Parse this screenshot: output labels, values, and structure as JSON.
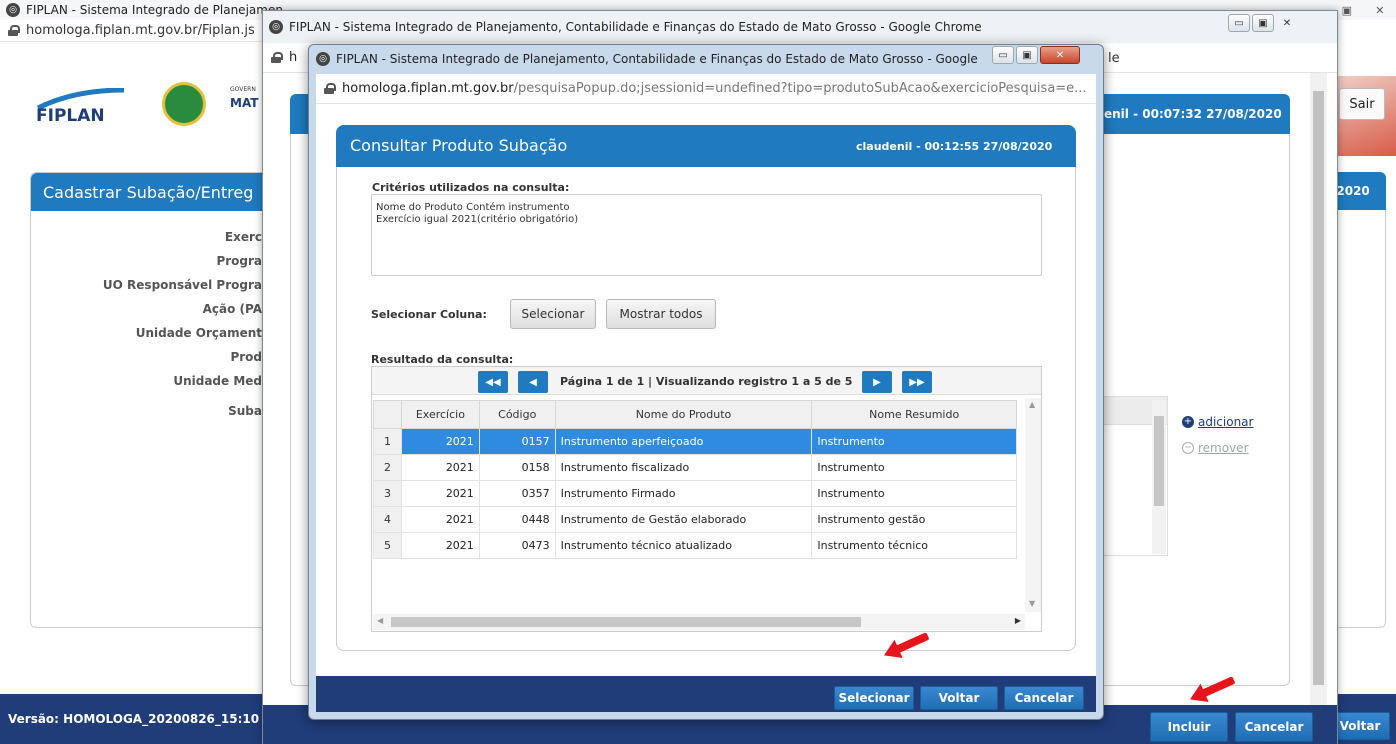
{
  "back": {
    "title": "FIPLAN - Sistema Integrado de Planejamen",
    "url": "homologa.fiplan.mt.gov.br/Fiplan.js",
    "logo": "FIPLAN",
    "gov": "GOVERN",
    "gov2": "MAT",
    "sair": "Sair",
    "form_title": "Cadastrar Subação/Entreg",
    "fields": [
      "Exerc",
      "Progra",
      "UO Responsável Progra",
      "Ação (PA",
      "Unidade Orçament",
      "Prod",
      "Unidade Med",
      "Suba"
    ],
    "version": "Versão: HOMOLOGA_20200826_15:10",
    "voltar": "Voltar",
    "date_right": "/2020"
  },
  "mid": {
    "title": "FIPLAN - Sistema Integrado de Planejamento, Contabilidade e Finanças do Estado de Mato Grosso - Google Chrome",
    "url_frag": "h",
    "url_frag_right": "le",
    "session": "enil - 00:07:32 27/08/2020",
    "adicionar": "adicionar",
    "remover": "remover",
    "incluir": "Incluir",
    "cancelar": "Cancelar"
  },
  "popup": {
    "title": "FIPLAN - Sistema Integrado de Planejamento, Contabilidade e Finanças do Estado de Mato Grosso - Google Chrome",
    "url_host": "homologa.fiplan.mt.gov.br",
    "url_path": "/pesquisaPopup.do;jsessionid=undefined?tipo=produtoSubAcao&exercicioPesquisa=e...",
    "panel_title": "Consultar Produto Subação",
    "session": "claudenil - 00:12:55 27/08/2020",
    "criteria_label": "Critérios utilizados na consulta:",
    "criteria_line1": "Nome do Produto Contém instrumento",
    "criteria_line2": "Exercício igual 2021(critério obrigatório)",
    "select_col_label": "Selecionar Coluna:",
    "btn_selecionar": "Selecionar",
    "btn_mostrar": "Mostrar todos",
    "result_label": "Resultado da consulta:",
    "pager": "Página 1 de 1 | Visualizando registro 1 a 5 de 5",
    "columns": [
      "Exercício",
      "Código",
      "Nome do Produto",
      "Nome Resumido"
    ],
    "rows": [
      [
        "1",
        "2021",
        "0157",
        "Instrumento aperfeiçoado",
        "Instrumento"
      ],
      [
        "2",
        "2021",
        "0158",
        "Instrumento fiscalizado",
        "Instrumento"
      ],
      [
        "3",
        "2021",
        "0357",
        "Instrumento Firmado",
        "Instrumento"
      ],
      [
        "4",
        "2021",
        "0448",
        "Instrumento de Gestão elaborado",
        "Instrumento gestão"
      ],
      [
        "5",
        "2021",
        "0473",
        "Instrumento técnico atualizado",
        "Instrumento técnico"
      ]
    ],
    "footer_selecionar": "Selecionar",
    "footer_voltar": "Voltar",
    "footer_cancelar": "Cancelar"
  },
  "colors": {
    "header_blue": "#1f7abf",
    "nav_blue": "#203d7a",
    "selected_row": "#2f8be0",
    "arrow_red": "#e8141c"
  }
}
